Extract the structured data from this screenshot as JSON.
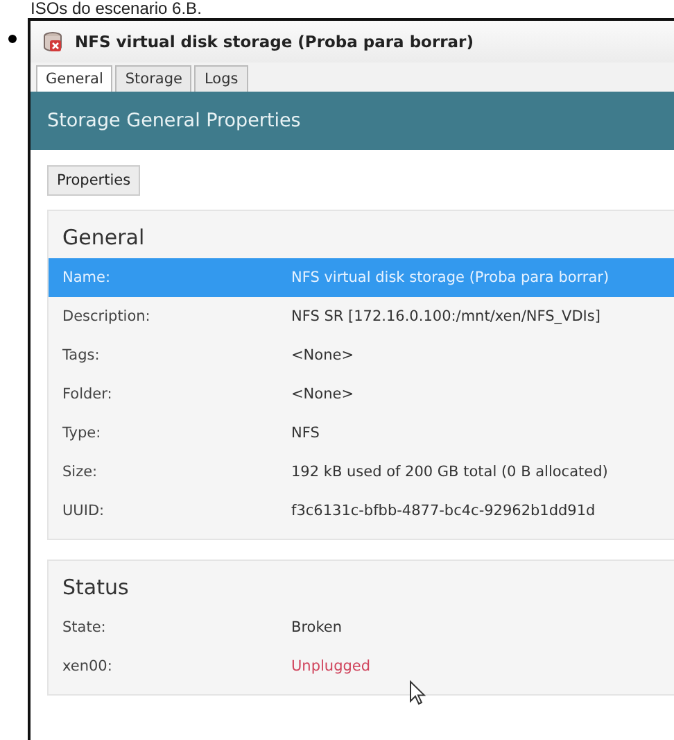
{
  "page_heading": "ISOs do escenario 6.B.",
  "window": {
    "title": "NFS virtual disk storage (Proba para borrar)"
  },
  "tabs": [
    {
      "label": "General",
      "selected": true
    },
    {
      "label": "Storage",
      "selected": false
    },
    {
      "label": "Logs",
      "selected": false
    }
  ],
  "banner": "Storage General Properties",
  "properties_button": "Properties",
  "sections": [
    {
      "title": "General",
      "rows": [
        {
          "label": "Name:",
          "value": "NFS virtual disk storage (Proba para borrar)",
          "selected": true
        },
        {
          "label": "Description:",
          "value": "NFS SR [172.16.0.100:/mnt/xen/NFS_VDIs]",
          "selected": false
        },
        {
          "label": "Tags:",
          "value": "<None>",
          "selected": false
        },
        {
          "label": "Folder:",
          "value": "<None>",
          "selected": false
        },
        {
          "label": "Type:",
          "value": "NFS",
          "selected": false
        },
        {
          "label": "Size:",
          "value": "192 kB used of 200 GB total (0 B allocated)",
          "selected": false
        },
        {
          "label": "UUID:",
          "value": "f3c6131c-bfbb-4877-bc4c-92962b1dd91d",
          "selected": false
        }
      ]
    },
    {
      "title": "Status",
      "rows": [
        {
          "label": "State:",
          "value": "Broken",
          "selected": false,
          "alert": false
        },
        {
          "label": "xen00:",
          "value": "Unplugged",
          "selected": false,
          "alert": true
        }
      ]
    }
  ]
}
